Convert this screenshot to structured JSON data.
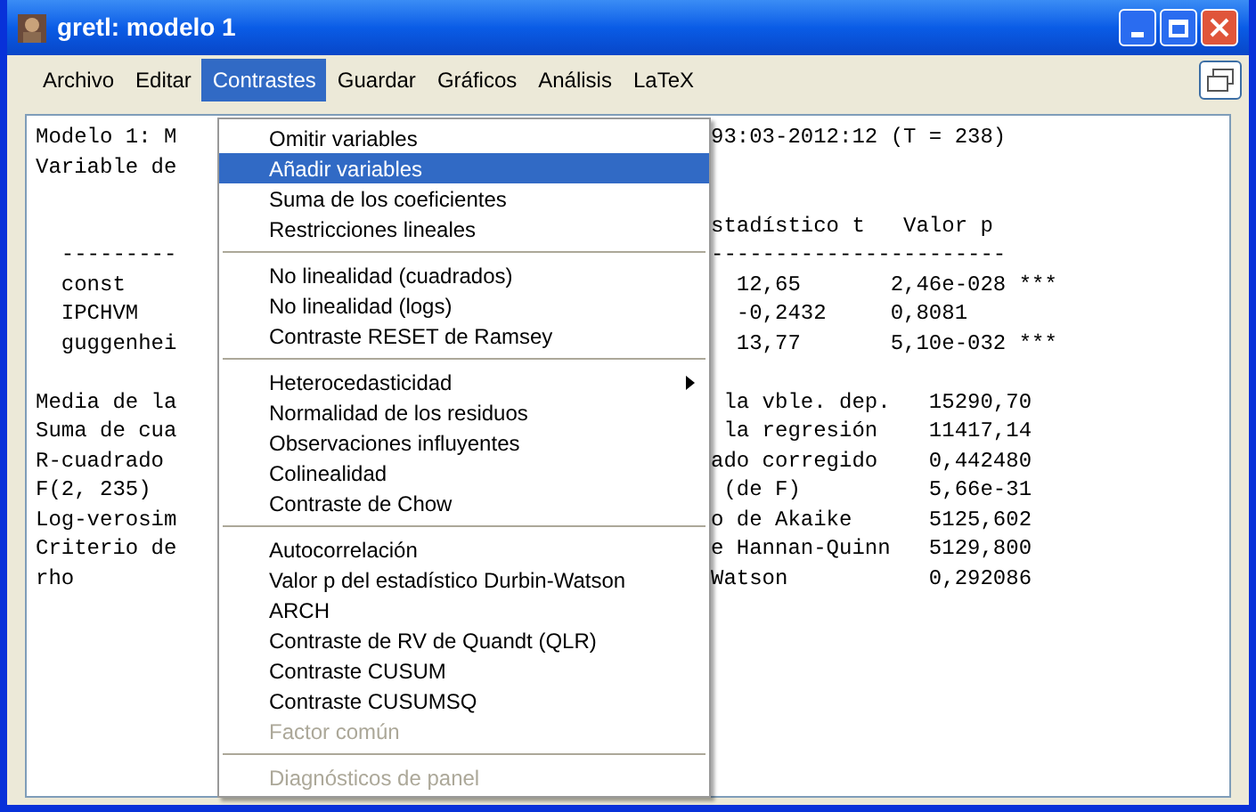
{
  "window": {
    "title": "gretl: modelo 1"
  },
  "menubar": [
    {
      "label": "Archivo",
      "selected": false
    },
    {
      "label": "Editar",
      "selected": false
    },
    {
      "label": "Contrastes",
      "selected": true
    },
    {
      "label": "Guardar",
      "selected": false
    },
    {
      "label": "Gráficos",
      "selected": false
    },
    {
      "label": "Análisis",
      "selected": false
    },
    {
      "label": "LaTeX",
      "selected": false
    }
  ],
  "output_lines": [
    {
      "left": "Modelo 1: M",
      "right": "93:03-2012:12 (T = 238)",
      "gap_before": false
    },
    {
      "left": "Variable de",
      "gap_before": false
    },
    {
      "right": "stadístico t   Valor p",
      "gap_before": true
    },
    {
      "left": "  ---------",
      "right": "-----------------------",
      "gap_before": false
    },
    {
      "left": "  const",
      "right": "  12,65       2,46e-028 ***",
      "gap_before": false
    },
    {
      "left": "  IPCHVM",
      "right": "  -0,2432     0,8081",
      "gap_before": false
    },
    {
      "left": "  guggenhei",
      "right": "  13,77       5,10e-032 ***",
      "gap_before": false
    },
    {
      "left": "Media de la",
      "right": " la vble. dep.   15290,70",
      "gap_before": true
    },
    {
      "left": "Suma de cua",
      "right": " la regresión    11417,14",
      "gap_before": false
    },
    {
      "left": "R-cuadrado",
      "right": "ado corregido    0,442480",
      "gap_before": false
    },
    {
      "left": "F(2, 235)",
      "right": " (de F)          5,66e-31",
      "gap_before": false
    },
    {
      "left": "Log-verosim",
      "right": "o de Akaike      5125,602",
      "gap_before": false
    },
    {
      "left": "Criterio de",
      "right": "e Hannan-Quinn   5129,800",
      "gap_before": false
    },
    {
      "left": "rho",
      "right": "Watson           0,292086",
      "gap_before": false
    }
  ],
  "dropdown": [
    {
      "kind": "item",
      "label": "Omitir variables",
      "selected": false,
      "disabled": false
    },
    {
      "kind": "item",
      "label": "Añadir variables",
      "selected": true,
      "disabled": false
    },
    {
      "kind": "item",
      "label": "Suma de los coeficientes",
      "selected": false,
      "disabled": false
    },
    {
      "kind": "item",
      "label": "Restricciones lineales",
      "selected": false,
      "disabled": false
    },
    {
      "kind": "separator"
    },
    {
      "kind": "item",
      "label": "No linealidad (cuadrados)",
      "selected": false,
      "disabled": false
    },
    {
      "kind": "item",
      "label": "No linealidad (logs)",
      "selected": false,
      "disabled": false
    },
    {
      "kind": "item",
      "label": "Contraste RESET de Ramsey",
      "selected": false,
      "disabled": false
    },
    {
      "kind": "separator"
    },
    {
      "kind": "submenu",
      "label": "Heterocedasticidad",
      "selected": false,
      "disabled": false
    },
    {
      "kind": "item",
      "label": "Normalidad de los residuos",
      "selected": false,
      "disabled": false
    },
    {
      "kind": "item",
      "label": "Observaciones influyentes",
      "selected": false,
      "disabled": false
    },
    {
      "kind": "item",
      "label": "Colinealidad",
      "selected": false,
      "disabled": false
    },
    {
      "kind": "item",
      "label": "Contraste de Chow",
      "selected": false,
      "disabled": false
    },
    {
      "kind": "separator"
    },
    {
      "kind": "item",
      "label": "Autocorrelación",
      "selected": false,
      "disabled": false
    },
    {
      "kind": "item",
      "label": "Valor p del estadístico Durbin-Watson",
      "selected": false,
      "disabled": false
    },
    {
      "kind": "item",
      "label": "ARCH",
      "selected": false,
      "disabled": false
    },
    {
      "kind": "item",
      "label": "Contraste de RV de Quandt (QLR)",
      "selected": false,
      "disabled": false
    },
    {
      "kind": "item",
      "label": "Contraste CUSUM",
      "selected": false,
      "disabled": false
    },
    {
      "kind": "item",
      "label": "Contraste CUSUMSQ",
      "selected": false,
      "disabled": false
    },
    {
      "kind": "item",
      "label": "Factor común",
      "selected": false,
      "disabled": true
    },
    {
      "kind": "separator"
    },
    {
      "kind": "item",
      "label": "Diagnósticos de panel",
      "selected": false,
      "disabled": true
    }
  ]
}
